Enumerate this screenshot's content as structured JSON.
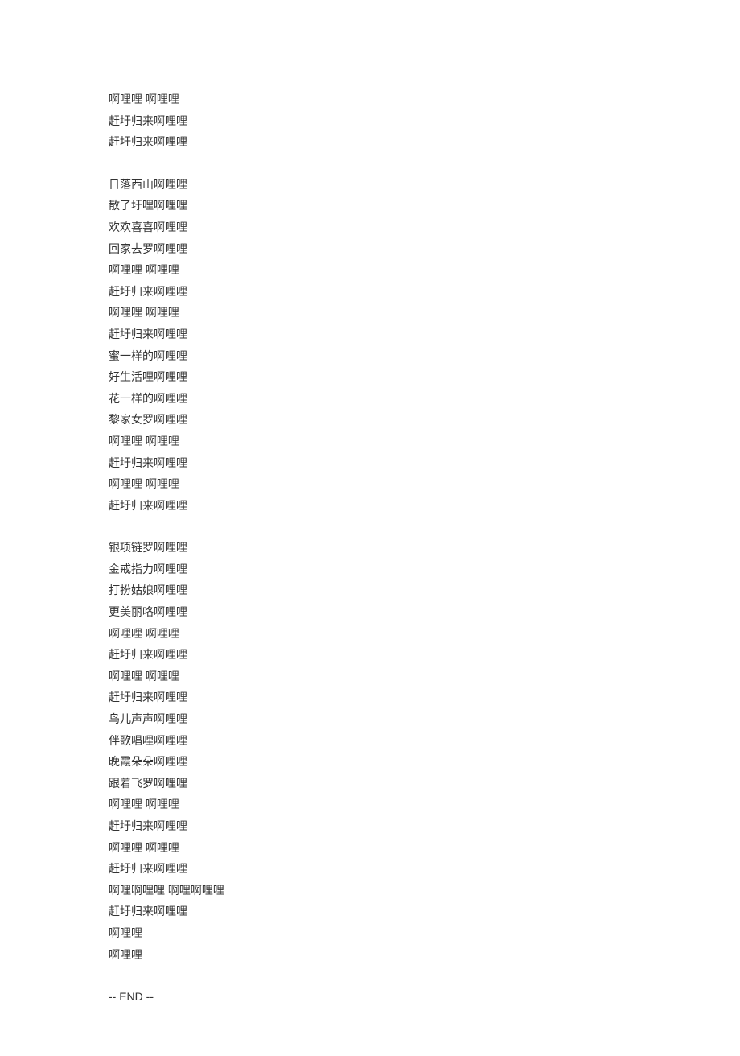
{
  "stanzas": [
    {
      "lines": [
        "啊哩哩 啊哩哩",
        "赶圩归来啊哩哩",
        "赶圩归来啊哩哩"
      ]
    },
    {
      "lines": [
        "日落西山啊哩哩",
        "散了圩哩啊哩哩",
        "欢欢喜喜啊哩哩",
        "回家去罗啊哩哩",
        "啊哩哩 啊哩哩",
        "赶圩归来啊哩哩",
        "啊哩哩 啊哩哩",
        "赶圩归来啊哩哩",
        "蜜一样的啊哩哩",
        "好生活哩啊哩哩",
        "花一样的啊哩哩",
        "黎家女罗啊哩哩",
        "啊哩哩 啊哩哩",
        "赶圩归来啊哩哩",
        "啊哩哩 啊哩哩",
        "赶圩归来啊哩哩"
      ]
    },
    {
      "lines": [
        "银项链罗啊哩哩",
        "金戒指力啊哩哩",
        "打扮姑娘啊哩哩",
        "更美丽咯啊哩哩",
        "啊哩哩 啊哩哩",
        "赶圩归来啊哩哩",
        "啊哩哩 啊哩哩",
        "赶圩归来啊哩哩",
        "鸟儿声声啊哩哩",
        "伴歌唱哩啊哩哩",
        "晚霞朵朵啊哩哩",
        "跟着飞罗啊哩哩",
        "啊哩哩 啊哩哩",
        "赶圩归来啊哩哩",
        "啊哩哩 啊哩哩",
        "赶圩归来啊哩哩",
        "啊哩啊哩哩 啊哩啊哩哩",
        "赶圩归来啊哩哩",
        "啊哩哩",
        "啊哩哩"
      ]
    }
  ],
  "endMarker": "-- END --"
}
